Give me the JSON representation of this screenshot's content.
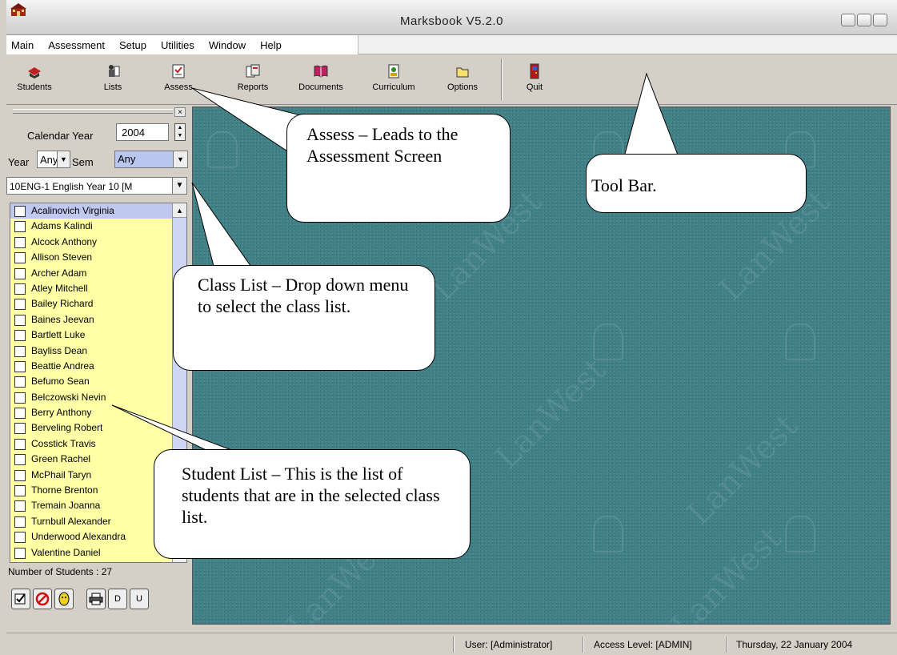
{
  "window": {
    "title": "Marksbook V5.2.0"
  },
  "menu": [
    "Main",
    "Assessment",
    "Setup",
    "Utilities",
    "Window",
    "Help"
  ],
  "toolbar": {
    "buttons": [
      {
        "label": "Students",
        "icon": "students-icon"
      },
      {
        "label": "Lists",
        "icon": "lists-icon"
      },
      {
        "label": "Assess",
        "icon": "assess-icon"
      },
      {
        "label": "Reports",
        "icon": "reports-icon"
      },
      {
        "label": "Documents",
        "icon": "documents-icon"
      },
      {
        "label": "Curriculum",
        "icon": "curriculum-icon"
      },
      {
        "label": "Options",
        "icon": "options-icon"
      },
      {
        "label": "Quit",
        "icon": "quit-icon"
      }
    ]
  },
  "filters": {
    "calendar_year_label": "Calendar Year",
    "calendar_year_value": "2004",
    "year_label": "Year",
    "year_value": "Any",
    "sem_label": "Sem",
    "sem_value": "Any",
    "class_value": "10ENG-1 English Year 10 [M"
  },
  "students": [
    "Acalinovich Virginia",
    "Adams Kalindi",
    "Alcock Anthony",
    "Allison Steven",
    "Archer Adam",
    "Atley Mitchell",
    "Bailey Richard",
    "Baines Jeevan",
    "Bartlett Luke",
    "Bayliss Dean",
    "Beattie Andrea",
    "Befumo Sean",
    "Belczowski Nevin",
    "Berry Anthony",
    "Berveling Robert",
    "Cosstick Travis",
    "Green Rachel",
    "McPhail Taryn",
    "Thorne Brenton",
    "Tremain Joanna",
    "Turnbull Alexander",
    "Underwood Alexandra",
    "Valentine Daniel"
  ],
  "selected_student_index": 0,
  "student_count_text": "Number of Students : 27",
  "bottom_buttons": {
    "d_label": "D",
    "u_label": "U"
  },
  "watermark_text": "LanWest",
  "status": {
    "user": "User: [Administrator]",
    "access": "Access Level: [ADMIN]",
    "date": "Thursday, 22 January 2004"
  },
  "callouts": {
    "assess": "Assess – Leads to the Assessment Screen",
    "toolbar": "Tool Bar.",
    "classlist": "Class List – Drop down menu to select the class list.",
    "studentlist": "Student List – This is the list of students that are in the selected class list."
  },
  "colors": {
    "workspace": "#3f7f86",
    "student_list_bg": "#ffffa6",
    "selection": "#bfc9f0"
  }
}
